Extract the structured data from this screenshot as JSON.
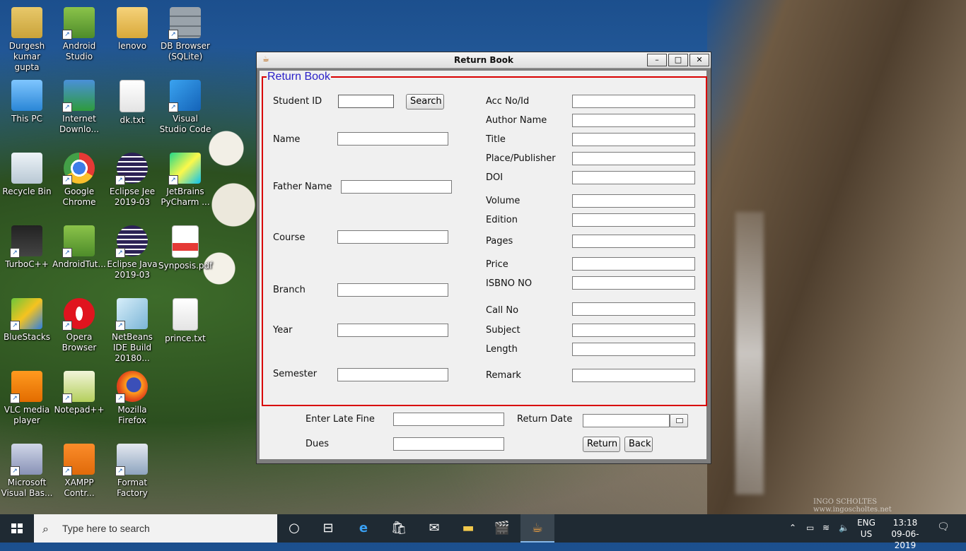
{
  "desktop": {
    "icons": [
      {
        "label": "Durgesh kumar gupta",
        "icon": "user-folder-icon"
      },
      {
        "label": "Android Studio",
        "icon": "android-studio-icon"
      },
      {
        "label": "lenovo",
        "icon": "pdf-folder-icon"
      },
      {
        "label": "DB Browser (SQLite)",
        "icon": "database-icon"
      },
      {
        "label": "This PC",
        "icon": "computer-icon"
      },
      {
        "label": "Internet Downlo...",
        "icon": "download-manager-icon"
      },
      {
        "label": "dk.txt",
        "icon": "text-file-icon"
      },
      {
        "label": "Visual Studio Code",
        "icon": "vscode-icon"
      },
      {
        "label": "Recycle Bin",
        "icon": "recycle-bin-icon"
      },
      {
        "label": "Google Chrome",
        "icon": "chrome-icon"
      },
      {
        "label": "Eclipse Jee 2019-03",
        "icon": "eclipse-icon"
      },
      {
        "label": "JetBrains PyCharm ...",
        "icon": "pycharm-icon"
      },
      {
        "label": "TurboC++",
        "icon": "turboc-icon"
      },
      {
        "label": "AndroidTut...",
        "icon": "android-studio-icon"
      },
      {
        "label": "Eclipse Java 2019-03",
        "icon": "eclipse-icon"
      },
      {
        "label": "Synposis.pdf",
        "icon": "pdf-file-icon"
      },
      {
        "label": "BlueStacks",
        "icon": "bluestacks-icon"
      },
      {
        "label": "Opera Browser",
        "icon": "opera-icon"
      },
      {
        "label": "NetBeans IDE Build 20180...",
        "icon": "netbeans-icon"
      },
      {
        "label": "prince.txt",
        "icon": "text-file-icon"
      },
      {
        "label": "VLC media player",
        "icon": "vlc-icon"
      },
      {
        "label": "Notepad++",
        "icon": "notepadpp-icon"
      },
      {
        "label": "Mozilla Firefox",
        "icon": "firefox-icon"
      },
      {
        "label": "Microsoft Visual Bas...",
        "icon": "visual-basic-icon"
      },
      {
        "label": "XAMPP Contr...",
        "icon": "xampp-icon"
      },
      {
        "label": "Format Factory",
        "icon": "format-factory-icon"
      }
    ],
    "watermark_line1": "INGO SCHOLTES",
    "watermark_line2": "www.ingoscholtes.net"
  },
  "window": {
    "title": "Return Book",
    "controls": {
      "minimize": "–",
      "maximize": "□",
      "close": "✕"
    },
    "group_title": "Return Book",
    "left": {
      "student_id_label": "Student ID",
      "student_id_value": "",
      "search_button": "Search",
      "name_label": "Name",
      "father_name_label": "Father Name",
      "course_label": "Course",
      "branch_label": "Branch",
      "year_label": "Year",
      "semester_label": "Semester"
    },
    "right": {
      "acc_no_label": "Acc No/Id",
      "author_label": "Author Name",
      "title_label": "Title",
      "publisher_label": "Place/Publisher",
      "doi_label": "DOI",
      "volume_label": "Volume",
      "edition_label": "Edition",
      "pages_label": "Pages",
      "price_label": "Price",
      "isbn_label": "ISBNO NO",
      "call_no_label": "Call No",
      "subject_label": "Subject",
      "length_label": "Length",
      "remark_label": "Remark"
    },
    "bottom": {
      "late_fine_label": "Enter Late Fine",
      "return_date_label": "Return Date",
      "dues_label": "Dues",
      "return_button": "Return",
      "back_button": "Back"
    }
  },
  "taskbar": {
    "search_placeholder": "Type here to search",
    "language_line1": "ENG",
    "language_line2": "US",
    "time": "13:18",
    "date": "09-06-2019"
  }
}
